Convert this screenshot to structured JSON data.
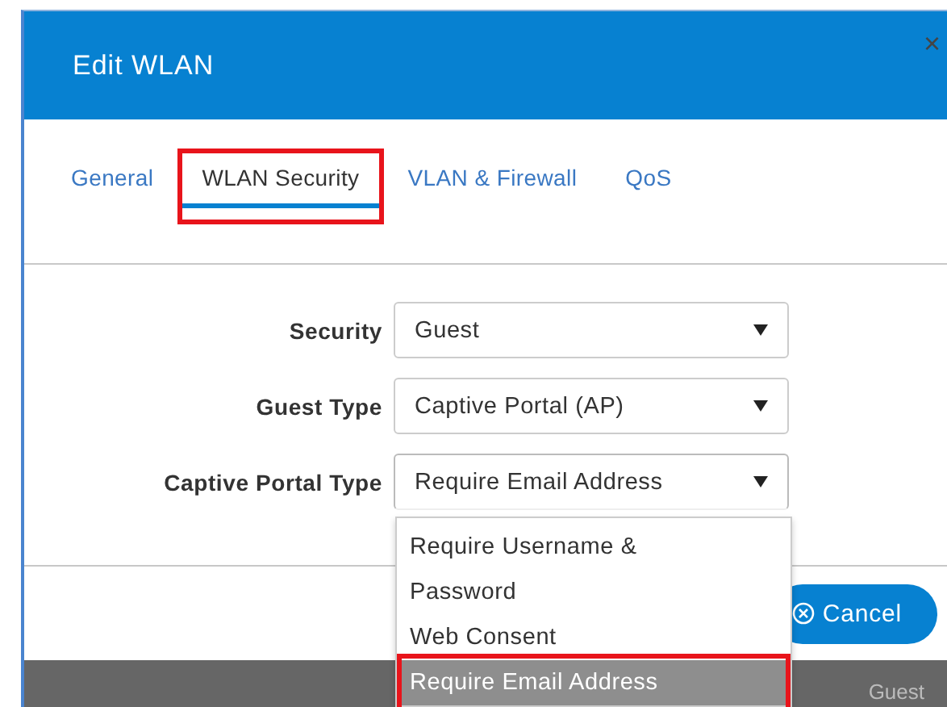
{
  "dialog": {
    "title": "Edit WLAN",
    "close": "×"
  },
  "tabs": [
    {
      "label": "General",
      "selected": false,
      "highlighted": false
    },
    {
      "label": "WLAN Security",
      "selected": true,
      "highlighted": true
    },
    {
      "label": "VLAN & Firewall",
      "selected": false,
      "highlighted": false
    },
    {
      "label": "QoS",
      "selected": false,
      "highlighted": false
    }
  ],
  "fields": [
    {
      "label": "Security",
      "value": "Guest",
      "open": false
    },
    {
      "label": "Guest Type",
      "value": "Captive Portal (AP)",
      "open": false
    },
    {
      "label": "Captive Portal Type",
      "value": "Require Email Address",
      "open": true
    }
  ],
  "dropdown_options": [
    {
      "label": "Require Username & Password",
      "selected": false,
      "highlighted": false
    },
    {
      "label": "Web Consent",
      "selected": false,
      "highlighted": false
    },
    {
      "label": "Require Email Address",
      "selected": true,
      "highlighted": true
    }
  ],
  "buttons": [
    {
      "label": "Cancel"
    }
  ],
  "background_table": {
    "cell": "Guest"
  }
}
